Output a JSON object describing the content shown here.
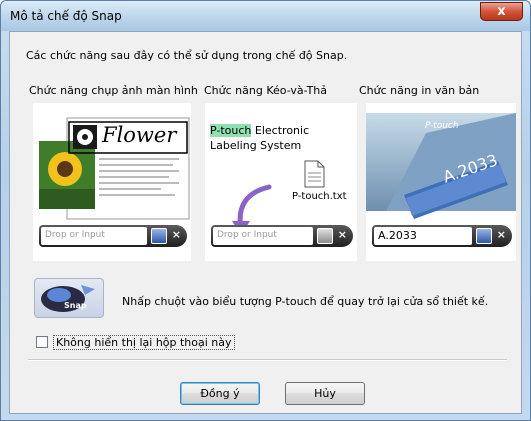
{
  "window": {
    "title": "Mô tả chế độ Snap",
    "close_label": "x"
  },
  "intro": "Các chức năng sau đây có thể sử dụng trong chế độ Snap.",
  "columns": [
    {
      "title": "Chức năng chụp ảnh màn hình",
      "image_text": "Flower",
      "drop_placeholder": "Drop or Input"
    },
    {
      "title": "Chức năng Kéo-và-Thả",
      "label_highlight": "P-touch",
      "label_line1_rest": " Electronic",
      "label_line2": "Labeling System",
      "file_name": "P-touch.txt",
      "drop_placeholder": "Drop or Input"
    },
    {
      "title": "Chức năng in văn bản",
      "tape_text": "A.2033",
      "tape_brand": "P-touch",
      "input_value": "A.2033"
    }
  ],
  "snap_icon": {
    "label": "Snap",
    "icon": "snap-icon"
  },
  "note": "Nhấp chuột vào biểu tượng P-touch để quay trở lại cửa sổ thiết kế.",
  "checkbox": {
    "label": "Không hiển thị lại hộp thoại này",
    "checked": false
  },
  "buttons": {
    "ok": "Đồng ý",
    "cancel": "Hủy"
  }
}
